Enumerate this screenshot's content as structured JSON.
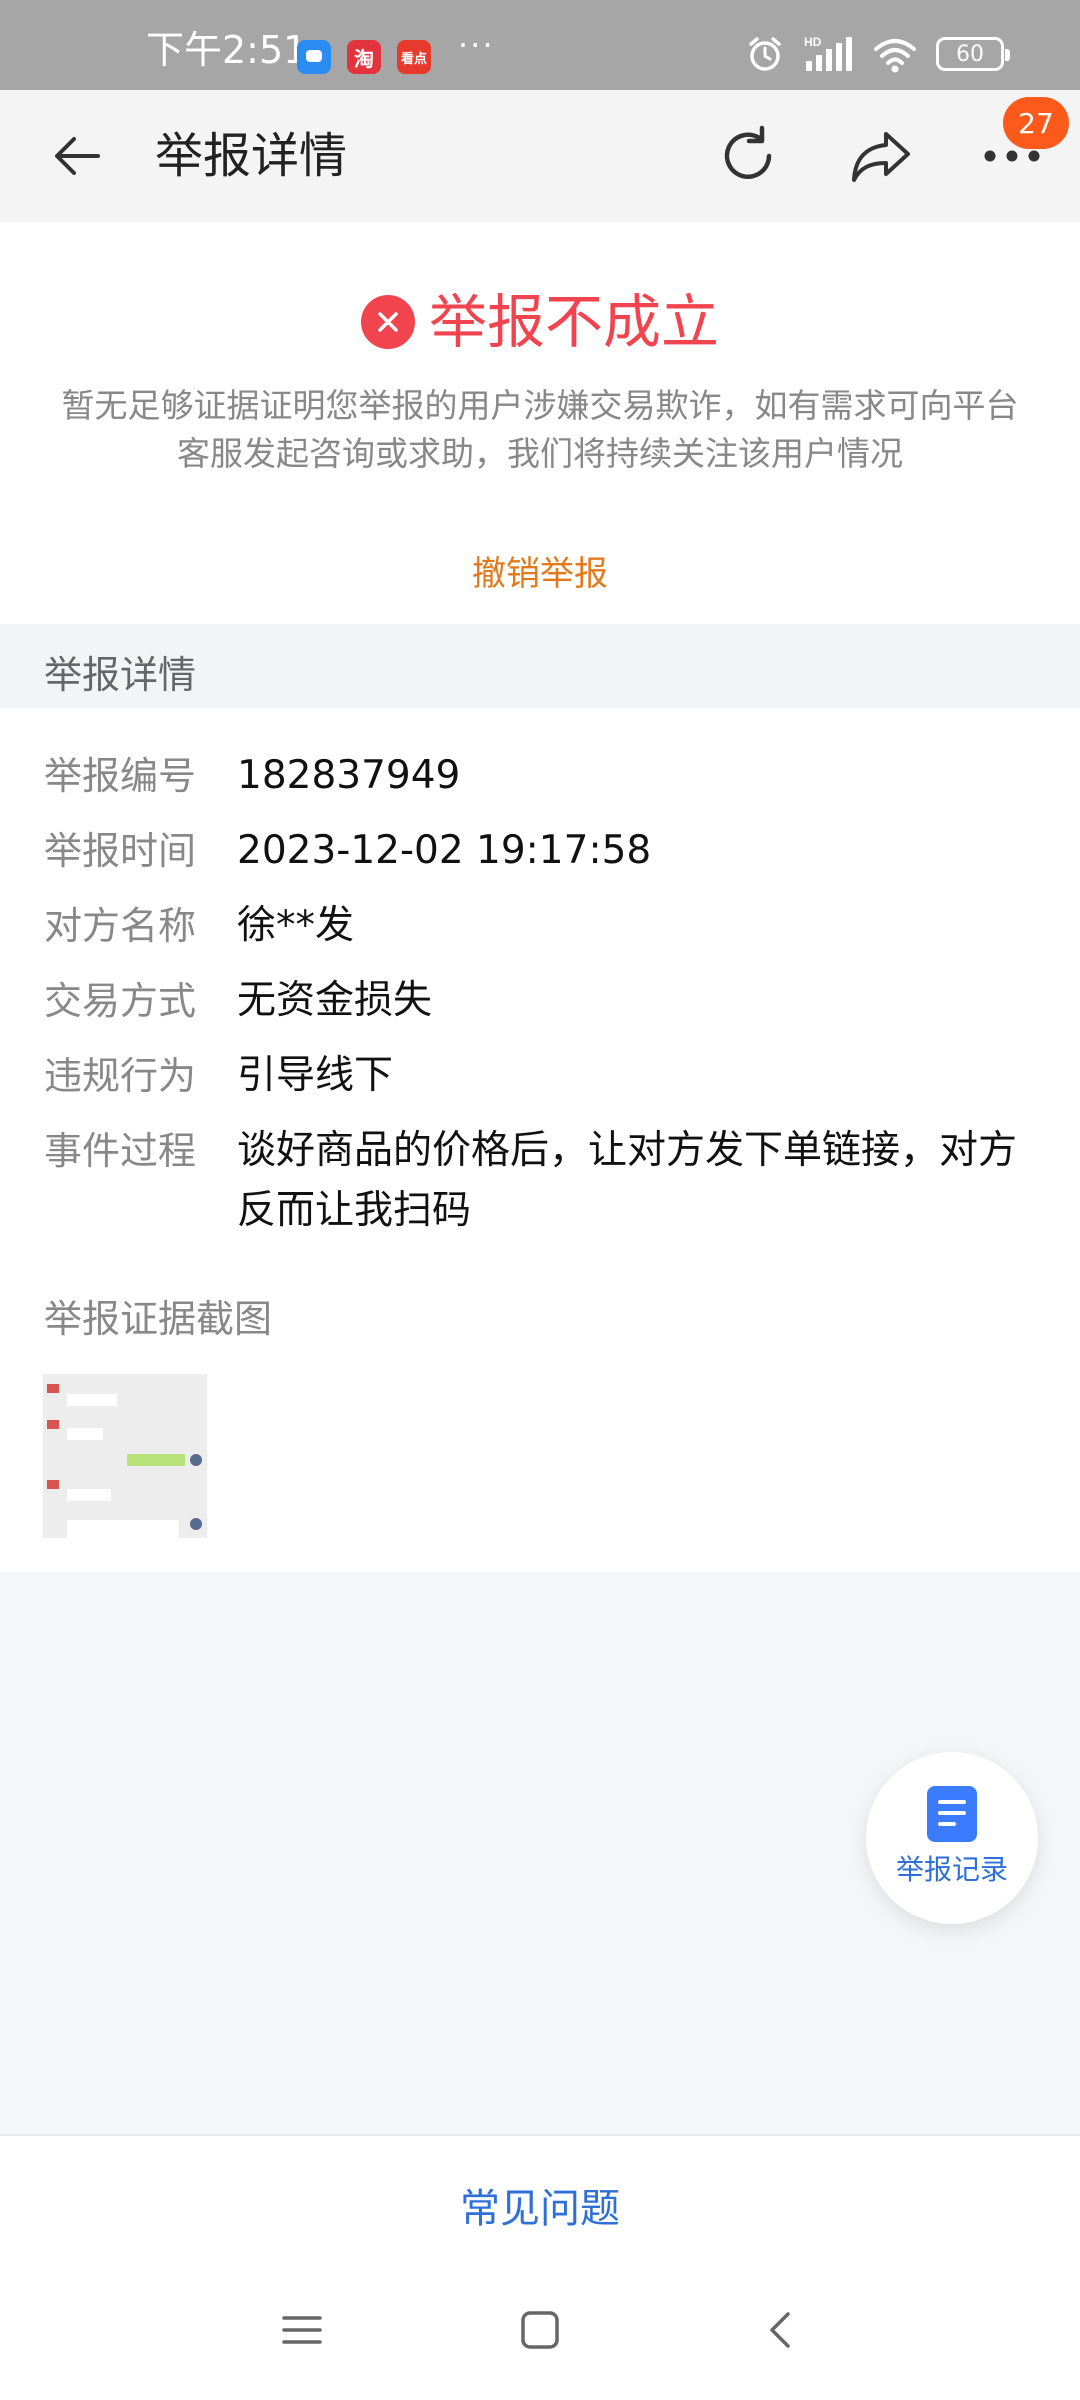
{
  "status_bar": {
    "time": "下午2:51",
    "apps": [
      {
        "icon": "chat-app-icon",
        "text": "",
        "color": "#2a8cf0"
      },
      {
        "icon": "taobao-icon",
        "text": "淘",
        "color": "#e2333f"
      },
      {
        "icon": "news-app-icon",
        "text": "看点",
        "color": "#e53a2c"
      }
    ],
    "more_dots": "···",
    "battery": "60",
    "network": "HD"
  },
  "nav": {
    "title": "举报详情",
    "badge_count": "27"
  },
  "result": {
    "status": "举报不成立",
    "description": "暂无足够证据证明您举报的用户涉嫌交易欺诈，如有需求可向平台客服发起咨询或求助，我们将持续关注该用户情况",
    "withdraw_label": "撤销举报",
    "status_color": "#f2444e",
    "link_color": "#e27a1c"
  },
  "details": {
    "section_title": "举报详情",
    "rows": [
      {
        "label": "举报编号",
        "value": "182837949"
      },
      {
        "label": "举报时间",
        "value": "2023-12-02 19:17:58"
      },
      {
        "label": "对方名称",
        "value": "徐**发"
      },
      {
        "label": "交易方式",
        "value": "无资金损失"
      },
      {
        "label": "违规行为",
        "value": "引导线下"
      },
      {
        "label": "事件过程",
        "value": "谈好商品的价格后，让对方发下单链接，对方反而让我扫码"
      }
    ],
    "evidence_title": "举报证据截图"
  },
  "fab": {
    "label": "举报记录",
    "icon": "document-icon"
  },
  "footer": {
    "faq_label": "常见问题"
  }
}
